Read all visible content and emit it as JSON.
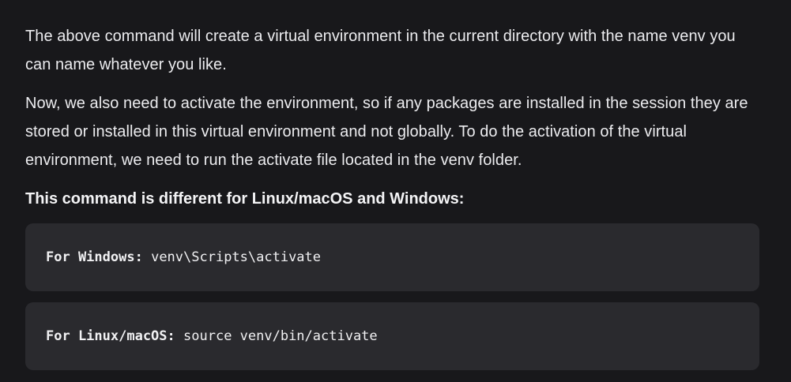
{
  "paragraphs": [
    "The above command will create a virtual environment in the current directory with the name venv you can name whatever you like.",
    "Now, we also need to activate the environment, so if any packages are installed in the session they are stored or installed in this virtual environment and not globally. To do the activation of the virtual environment, we need to run the activate file located in the venv folder."
  ],
  "heading": "This command is different for Linux/macOS and Windows:",
  "code_blocks": [
    {
      "label": "For Windows:",
      "command": "venv\\Scripts\\activate"
    },
    {
      "label": "For Linux/macOS:",
      "command": "source venv/bin/activate"
    }
  ]
}
